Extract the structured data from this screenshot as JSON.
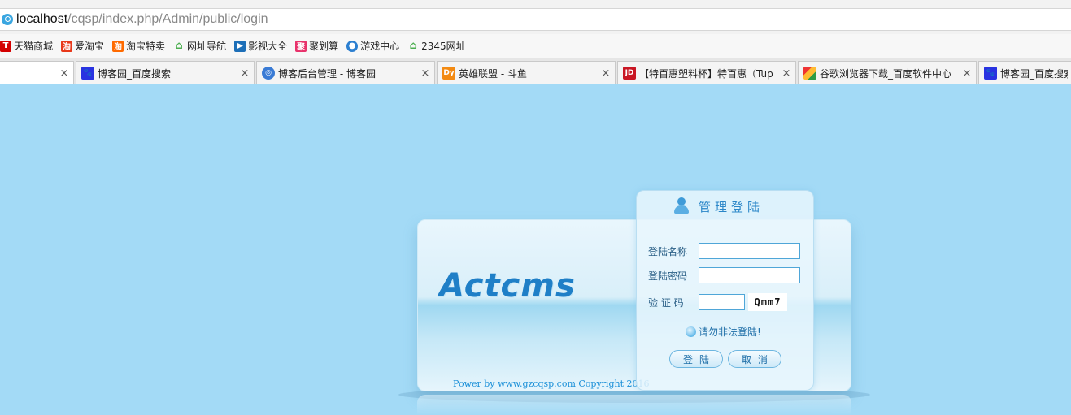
{
  "browser": {
    "url_host": "localhost",
    "url_path": "/cqsp/index.php/Admin/public/login",
    "bookmarks": [
      {
        "label": "天猫商城",
        "icon": "tmall-icon",
        "color": "#d40000"
      },
      {
        "label": "爱淘宝",
        "icon": "aitaobao-icon",
        "color": "#e8381a"
      },
      {
        "label": "淘宝特卖",
        "icon": "taobao-icon",
        "color": "#ff6a00"
      },
      {
        "label": "网址导航",
        "icon": "home-icon",
        "color": "#4caf50"
      },
      {
        "label": "影视大全",
        "icon": "film-icon",
        "color": "#1d6fb8"
      },
      {
        "label": "聚划算",
        "icon": "juhuasuan-icon",
        "color": "#e8326b"
      },
      {
        "label": "游戏中心",
        "icon": "game-icon",
        "color": "#2c7fd0"
      },
      {
        "label": "2345网址",
        "icon": "home-icon",
        "color": "#4caf50"
      }
    ],
    "tabs": [
      {
        "title": "",
        "icon": "",
        "close": "×",
        "active": true
      },
      {
        "title": "博客园_百度搜索",
        "icon": "baidu-icon",
        "color": "#2932e1",
        "close": "×"
      },
      {
        "title": "博客后台管理 - 博客园",
        "icon": "globe-icon",
        "color": "#3a7bd5",
        "close": "×"
      },
      {
        "title": "英雄联盟 - 斗鱼",
        "icon": "douyu-icon",
        "color": "#f38a12",
        "close": "×"
      },
      {
        "title": "【特百惠塑料杯】特百惠（Tup",
        "icon": "jd-icon",
        "color": "#c91623",
        "close": "×"
      },
      {
        "title": "谷歌浏览器下载_百度软件中心",
        "icon": "chrome-icon",
        "color": "#2e9b45",
        "close": "×"
      },
      {
        "title": "博客园_百度搜索",
        "icon": "baidu-icon",
        "color": "#2932e1",
        "close": ""
      }
    ]
  },
  "login": {
    "logo": "Actcms",
    "title": "管理登陆",
    "username_label": "登陆名称",
    "username_value": "",
    "password_label": "登陆密码",
    "password_value": "",
    "captcha_label": "验 证 码",
    "captcha_value": "",
    "captcha_text": "Qmm7",
    "warning": "请勿非法登陆!",
    "login_button": "登陆",
    "cancel_button": "取消",
    "copyright": "Power by www.gzcqsp.com Copyright 2016"
  },
  "colors": {
    "page_bg": "#a3daf6",
    "accent": "#2a86c8",
    "input_border": "#4fa6d8"
  }
}
